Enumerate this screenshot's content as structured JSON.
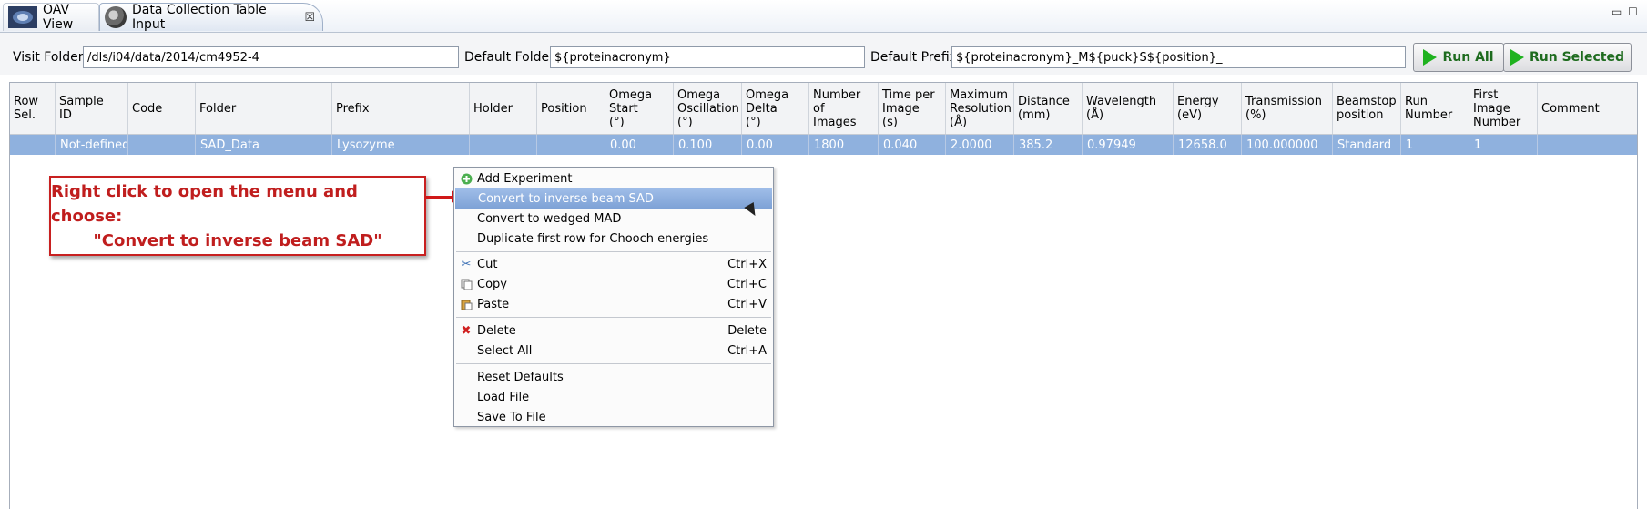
{
  "tabs": {
    "oav": {
      "label": "OAV View"
    },
    "dct": {
      "label": "Data Collection Table Input",
      "close": "☒"
    }
  },
  "window_controls": {
    "minimize": "▭",
    "maximize": "☐"
  },
  "folders": {
    "visit_label": "Visit Folder",
    "visit_value": "/dls/i04/data/2014/cm4952-4",
    "default_folder_label": "Default Folder",
    "default_folder_value": "${proteinacronym}",
    "default_prefix_label": "Default Prefix",
    "default_prefix_value": "${proteinacronym}_M${puck}S${position}_"
  },
  "toolbar": {
    "run_all": "Run All",
    "run_selected": "Run Selected"
  },
  "table": {
    "headers": [
      "Row\nSel.",
      "Sample\nID",
      "Code",
      "Folder",
      "Prefix",
      "Holder",
      "Position",
      "Omega\nStart\n(°)",
      "Omega\nOscillation\n(°)",
      "Omega\nDelta\n(°)",
      "Number\nof\nImages",
      "Time per\nImage\n(s)",
      "Maximum\nResolution\n(Å)",
      "Distance\n(mm)",
      "Wavelength\n(Å)",
      "Energy\n(eV)",
      "Transmission\n(%)",
      "Beamstop\nposition",
      "Run\nNumber",
      "First\nImage\nNumber",
      "Comment"
    ],
    "rows": [
      [
        "",
        "Not-defined",
        "",
        "SAD_Data",
        "Lysozyme",
        "",
        "",
        "0.00",
        "0.100",
        "0.00",
        "1800",
        "0.040",
        "2.0000",
        "385.2",
        "0.97949",
        "12658.0",
        "100.000000",
        "Standard",
        "1",
        "1",
        ""
      ]
    ]
  },
  "annotation": {
    "line1": "Right click to open the menu and choose:",
    "line2": "\"Convert to inverse beam SAD\""
  },
  "menu": {
    "add_experiment": "Add Experiment",
    "convert_inverse": "Convert to inverse beam SAD",
    "convert_wedged": "Convert to wedged MAD",
    "duplicate": "Duplicate first row for Chooch energies",
    "cut": "Cut",
    "cut_short": "Ctrl+X",
    "copy": "Copy",
    "copy_short": "Ctrl+C",
    "paste": "Paste",
    "paste_short": "Ctrl+V",
    "delete": "Delete",
    "delete_short": "Delete",
    "select_all": "Select All",
    "select_all_short": "Ctrl+A",
    "reset_defaults": "Reset Defaults",
    "load_file": "Load File",
    "save_to_file": "Save To File"
  },
  "colors": {
    "selection": "#8fb1de",
    "annotation_red": "#c82020",
    "run_green": "#1fb21f"
  }
}
